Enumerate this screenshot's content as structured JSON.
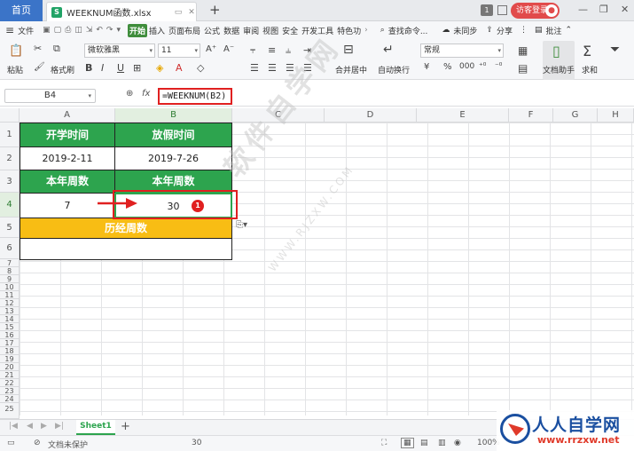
{
  "titlebar": {
    "home_tab": "首页",
    "file_tab": "WEEKNUM函数.xlsx",
    "add_tab": "+",
    "badge": "1",
    "login": "访客登录"
  },
  "ribbon": {
    "menu": [
      "文件",
      "",
      "",
      "",
      "",
      "",
      "",
      "",
      "",
      "开始",
      "插入",
      "页面布局",
      "公式",
      "数据",
      "审阅",
      "视图",
      "安全",
      "开发工具",
      "特色功"
    ],
    "search": "查找命令...",
    "sync": "未同步",
    "share": "分享",
    "comment": "批注",
    "paste": "粘贴",
    "format_painter": "格式刷",
    "font_name": "微软雅黑",
    "font_size": "11",
    "merge": "合并居中",
    "wrap": "自动换行",
    "number_format": "常规",
    "doc_assistant": "文档助手",
    "sum": "求和"
  },
  "formula_bar": {
    "name_box": "B4",
    "fx": "fx",
    "formula": "=WEEKNUM(B2)"
  },
  "columns": [
    "A",
    "B",
    "C",
    "D",
    "E",
    "F",
    "G",
    "H"
  ],
  "rows": [
    "1",
    "2",
    "3",
    "4",
    "5",
    "6",
    "7",
    "8",
    "9",
    "10",
    "11",
    "12",
    "13",
    "14",
    "15",
    "16",
    "17",
    "18",
    "19",
    "20",
    "21",
    "22",
    "23",
    "24",
    "25"
  ],
  "cells": {
    "a1": "开学时间",
    "b1": "放假时间",
    "a2": "2019-2-11",
    "b2": "2019-7-26",
    "a3": "本年周数",
    "b3": "本年周数",
    "a4": "7",
    "b4": "30",
    "a5": "历经周数",
    "a6": ""
  },
  "annotation": {
    "badge": "1"
  },
  "watermark": {
    "main": "软件自学网",
    "sub": "WWW.RJZXW.COM"
  },
  "sheets": [
    "Sheet1"
  ],
  "status": {
    "protect": "文档未保护",
    "value": "30",
    "zoom": "100%"
  },
  "logo": {
    "brand": "人人自学网",
    "url": "www.rrzxw.net"
  },
  "colors": {
    "header_green": "#2da44e",
    "accent_yellow": "#f8bd14",
    "annot_red": "#e02020",
    "wps_green": "#3f8d3c"
  }
}
